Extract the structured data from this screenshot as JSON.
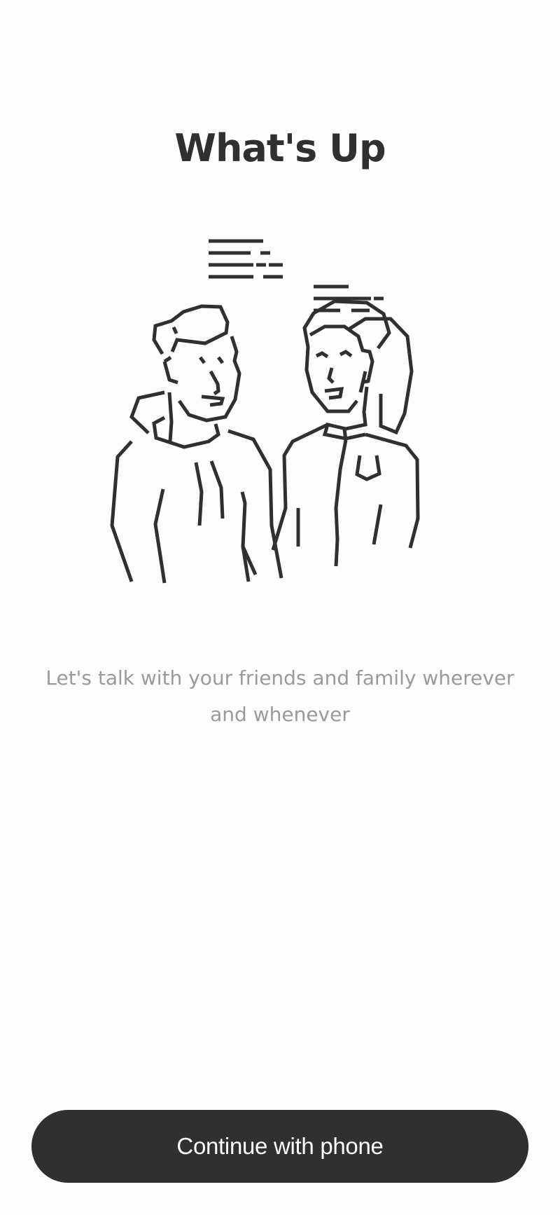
{
  "onboarding": {
    "title": "What's Up",
    "description": "Let's talk with your friends and family wherever and whenever",
    "continue_button_label": "Continue with phone"
  },
  "colors": {
    "background": "#fdfdfd",
    "primary_dark": "#303030",
    "text_muted": "#9a9a9a",
    "button_text": "#ffffff"
  },
  "illustration": {
    "icon": "two-people-chatting-line-art"
  }
}
